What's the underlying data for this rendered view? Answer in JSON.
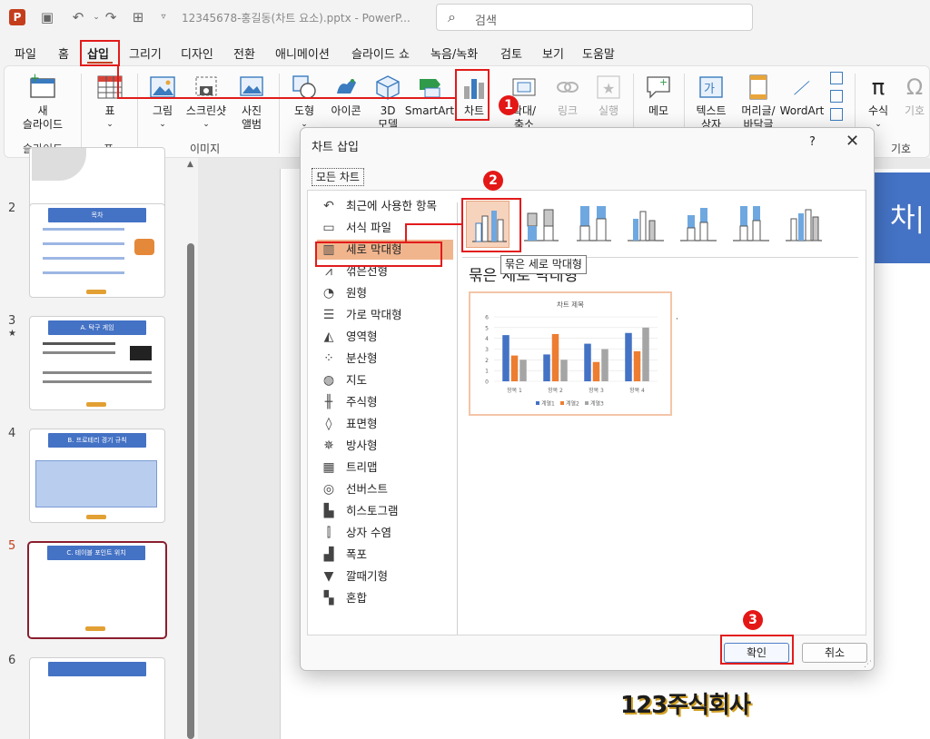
{
  "window": {
    "doc_title": "12345678-홍길동(차트 요소).pptx - PowerP...",
    "search_placeholder": "검색"
  },
  "menu": {
    "tabs": [
      "파일",
      "홈",
      "삽입",
      "그리기",
      "디자인",
      "전환",
      "애니메이션",
      "슬라이드 쇼",
      "녹음/녹화",
      "검토",
      "보기",
      "도움말"
    ],
    "active": "삽입"
  },
  "ribbon": {
    "new_slide": "새\n슬라이드",
    "slides_group": "슬라이드",
    "table": "표",
    "table_group": "표",
    "picture": "그림",
    "screenshot": "스크린샷",
    "photo_album": "사진\n앨범",
    "image_group": "이미지",
    "shapes": "도형",
    "icons": "아이콘",
    "models_3d": "3D\n모델",
    "smartart": "SmartArt",
    "chart": "차트",
    "zoom": "확대/\n축소",
    "link": "링크",
    "action": "실행",
    "comment": "메모",
    "textbox": "텍스트\n상자",
    "header_footer": "머리글/\n바닥글",
    "wordart": "WordArt",
    "equation": "수식",
    "symbol": "기호",
    "symbol_group": "기호",
    "equation_glyph": "π",
    "symbol_glyph": "Ω"
  },
  "slides": [
    {
      "num": "2",
      "title": "목차"
    },
    {
      "num": "3",
      "title": "A. 탁구 게임"
    },
    {
      "num": "4",
      "title": "B. 프로테리 경기 규칙"
    },
    {
      "num": "5",
      "title": "C. 테이블 포인트 위치"
    },
    {
      "num": "6",
      "title": ""
    }
  ],
  "slide_canvas": {
    "title_fragment": "차|"
  },
  "logo_text": "123주식회사",
  "dialog": {
    "title": "차트 삽입",
    "help": "?",
    "close": "✕",
    "tab": "모든 차트",
    "categories": [
      {
        "label": "최근에 사용한 항목",
        "icon": "recent-icon",
        "glyph": "↶"
      },
      {
        "label": "서식 파일",
        "icon": "folder-icon",
        "glyph": "▭"
      },
      {
        "label": "세로 막대형",
        "icon": "column-chart-icon",
        "glyph": "▥"
      },
      {
        "label": "꺾은선형",
        "icon": "line-chart-icon",
        "glyph": "⩘"
      },
      {
        "label": "원형",
        "icon": "pie-chart-icon",
        "glyph": "◔"
      },
      {
        "label": "가로 막대형",
        "icon": "bar-chart-icon",
        "glyph": "☰"
      },
      {
        "label": "영역형",
        "icon": "area-chart-icon",
        "glyph": "◭"
      },
      {
        "label": "분산형",
        "icon": "scatter-chart-icon",
        "glyph": "⁘"
      },
      {
        "label": "지도",
        "icon": "map-chart-icon",
        "glyph": "◍"
      },
      {
        "label": "주식형",
        "icon": "stock-chart-icon",
        "glyph": "╫"
      },
      {
        "label": "표면형",
        "icon": "surface-chart-icon",
        "glyph": "◊"
      },
      {
        "label": "방사형",
        "icon": "radar-chart-icon",
        "glyph": "✵"
      },
      {
        "label": "트리맵",
        "icon": "treemap-icon",
        "glyph": "▦"
      },
      {
        "label": "선버스트",
        "icon": "sunburst-icon",
        "glyph": "◎"
      },
      {
        "label": "히스토그램",
        "icon": "histogram-icon",
        "glyph": "▙"
      },
      {
        "label": "상자 수염",
        "icon": "box-whisker-icon",
        "glyph": "⫿"
      },
      {
        "label": "폭포",
        "icon": "waterfall-icon",
        "glyph": "▟"
      },
      {
        "label": "깔때기형",
        "icon": "funnel-icon",
        "glyph": "▼"
      },
      {
        "label": "혼합",
        "icon": "combo-chart-icon",
        "glyph": "▚"
      }
    ],
    "selected_category": "세로 막대형",
    "tooltip": "묶은 세로 막대형",
    "subtype_title": "묶은 세로 막대형",
    "ok": "확인",
    "cancel": "취소"
  },
  "annotations": {
    "badge1": "1",
    "badge2": "2",
    "badge3": "3",
    "color": "#e21b1b"
  },
  "chart_data": {
    "type": "bar",
    "title": "차트 제목",
    "categories": [
      "항목 1",
      "항목 2",
      "항목 3",
      "항목 4"
    ],
    "series": [
      {
        "name": "계열1",
        "values": [
          4.3,
          2.5,
          3.5,
          4.5
        ],
        "color": "#4472c4"
      },
      {
        "name": "계열2",
        "values": [
          2.4,
          4.4,
          1.8,
          2.8
        ],
        "color": "#ed7d31"
      },
      {
        "name": "계열3",
        "values": [
          2,
          2,
          3,
          5
        ],
        "color": "#a5a5a5"
      }
    ],
    "ylim": [
      0,
      6
    ],
    "yticks": [
      "0",
      "1",
      "2",
      "3",
      "4",
      "5",
      "6"
    ],
    "grid": true,
    "legend": "bottom"
  }
}
